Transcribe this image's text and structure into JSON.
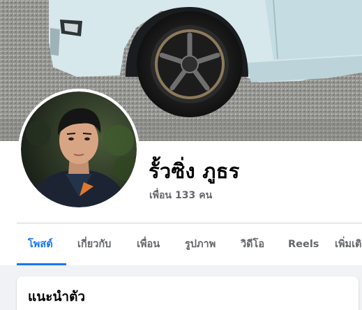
{
  "cover": {
    "image": "cover-photo-white-car-wheel"
  },
  "profile": {
    "avatar": "profile-photo-young-man",
    "name": "รั้วซิ่ง ภูธร",
    "friends_label": "เพื่อน",
    "friends_count": "133",
    "friends_unit": "คน"
  },
  "tabs": [
    {
      "label": "โพสต์",
      "active": true
    },
    {
      "label": "เกี่ยวกับ",
      "active": false
    },
    {
      "label": "เพื่อน",
      "active": false
    },
    {
      "label": "รูปภาพ",
      "active": false
    },
    {
      "label": "วิดีโอ",
      "active": false
    },
    {
      "label": "Reels",
      "active": false
    },
    {
      "label": "เพิ่มเติม",
      "active": false
    }
  ],
  "intro": {
    "title": "แนะนำตัว"
  },
  "colors": {
    "accent": "#1877f2",
    "secondary_text": "#65676b",
    "primary_text": "#050505",
    "feed_background": "#f0f2f5"
  }
}
